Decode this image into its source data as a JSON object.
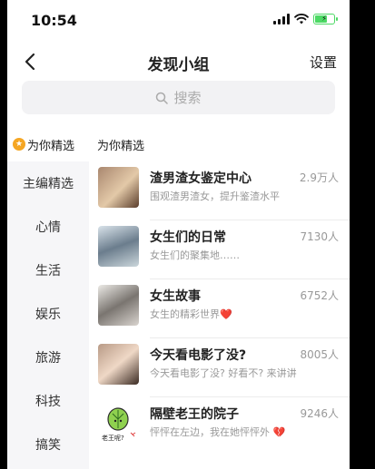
{
  "status_bar": {
    "time": "10:54"
  },
  "nav": {
    "title": "发现小组",
    "settings_label": "设置"
  },
  "search": {
    "placeholder": "搜索"
  },
  "sidebar": {
    "header": "为你精选",
    "items": [
      {
        "label": "主编精选"
      },
      {
        "label": "心情"
      },
      {
        "label": "生活"
      },
      {
        "label": "娱乐"
      },
      {
        "label": "旅游"
      },
      {
        "label": "科技"
      },
      {
        "label": "搞笑"
      }
    ]
  },
  "main": {
    "header": "为你精选",
    "groups": [
      {
        "name": "渣男渣女鉴定中心",
        "count": "2.9万人",
        "desc": "围观渣男渣女，提升鉴渣水平"
      },
      {
        "name": "女生们的日常",
        "count": "7130人",
        "desc": "女生们的聚集地……"
      },
      {
        "name": "女生故事",
        "count": "6752人",
        "desc": "女生的精彩世界❤️"
      },
      {
        "name": "今天看电影了没?",
        "count": "8005人",
        "desc": "今天看电影了没? 好看不? 来讲讲"
      },
      {
        "name": "隔壁老王的院子",
        "count": "9246人",
        "desc": "怦怦在左边，我在她怦怦外 💔",
        "thumb_text": "老王呢?"
      }
    ]
  },
  "colors": {
    "accent_star": "#f5a623",
    "battery": "#4cd964"
  }
}
